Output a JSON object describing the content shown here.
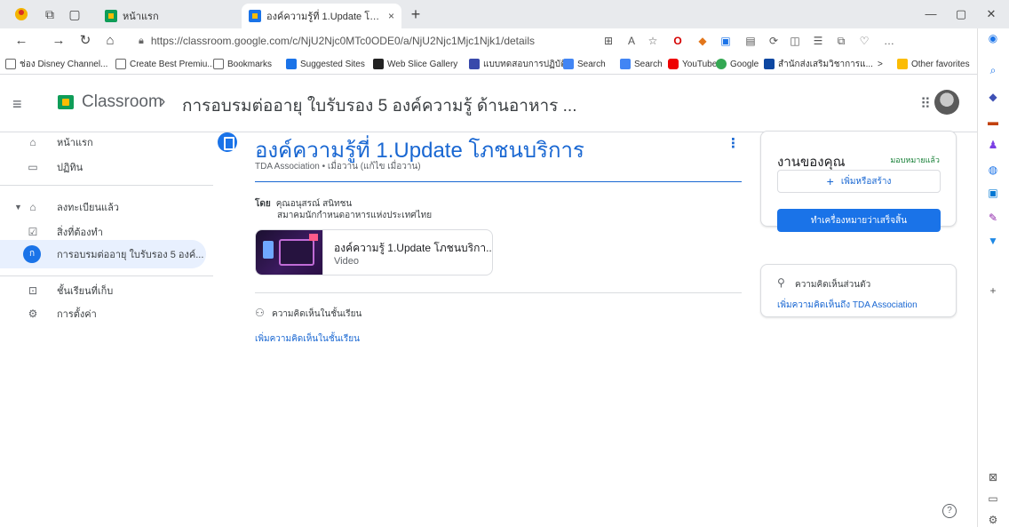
{
  "browser": {
    "tabs": [
      {
        "title": "หน้าแรก",
        "close": ""
      },
      {
        "title": "องค์ความรู้ที่ 1.Update โภชนบริการ",
        "close": "×"
      }
    ],
    "new_tab": "+",
    "window_controls": {
      "minimize": "—",
      "restore": "▢",
      "close": "✕"
    },
    "url": "https://classroom.google.com/c/NjU2Njc0MTc0ODE0/a/NjU2Njc1Mjc1Njk1/details",
    "bookmarks": [
      "ช่อง Disney Channel...",
      "Create Best Premiu...",
      "Bookmarks",
      "Suggested Sites",
      "Web Slice Gallery",
      "แบบทดสอบการปฏิบัติ...",
      "Search",
      "Search",
      "YouTube",
      "Google",
      "สำนักส่งเสริมวิชาการแ..."
    ],
    "overflow": ">",
    "other_favorites": "Other favorites"
  },
  "header": {
    "app_name": "Classroom",
    "separator": "›",
    "course_name": "การอบรมต่ออายุ ใบรับรอง 5 องค์ความรู้ ด้านอาหาร ..."
  },
  "nav": {
    "home": "หน้าแรก",
    "calendar": "ปฏิทิน",
    "enrolled": "ลงทะเบียนแล้ว",
    "todo": "สิ่งที่ต้องทำ",
    "course_initial": "ก",
    "course": "การอบรมต่ออายุ ใบรับรอง 5 องค์...",
    "archived": "ชั้นเรียนที่เก็บ",
    "settings": "การตั้งค่า"
  },
  "post": {
    "title": "องค์ความรู้ที่ 1.Update โภชนบริการ",
    "meta": "TDA Association • เมื่อวาน (แก้ไข เมื่อวาน)",
    "author_prefix": "โดย",
    "author_name": "คุณอนุสรณ์ สนิทชน",
    "author_org": "สมาคมนักกำหนดอาหารแห่งประเทศไทย",
    "attachment_title": "องค์ความรู้ 1.Update โภชนบริกา...",
    "attachment_type": "Video",
    "class_comments_label": "ความคิดเห็นในชั้นเรียน",
    "add_class_comment": "เพิ่มความคิดเห็นในชั้นเรียน"
  },
  "work": {
    "title": "งานของคุณ",
    "status": "มอบหมายแล้ว",
    "add_create": "เพิ่มหรือสร้าง",
    "mark_done": "ทำเครื่องหมายว่าเสร็จสิ้น"
  },
  "private_comments": {
    "title": "ความคิดเห็นส่วนตัว",
    "add_link": "เพิ่มความคิดเห็นถึง TDA Association"
  },
  "help": "?",
  "colors": {
    "accent": "#1a73e8",
    "link": "#1967d2",
    "assigned": "#188038"
  }
}
